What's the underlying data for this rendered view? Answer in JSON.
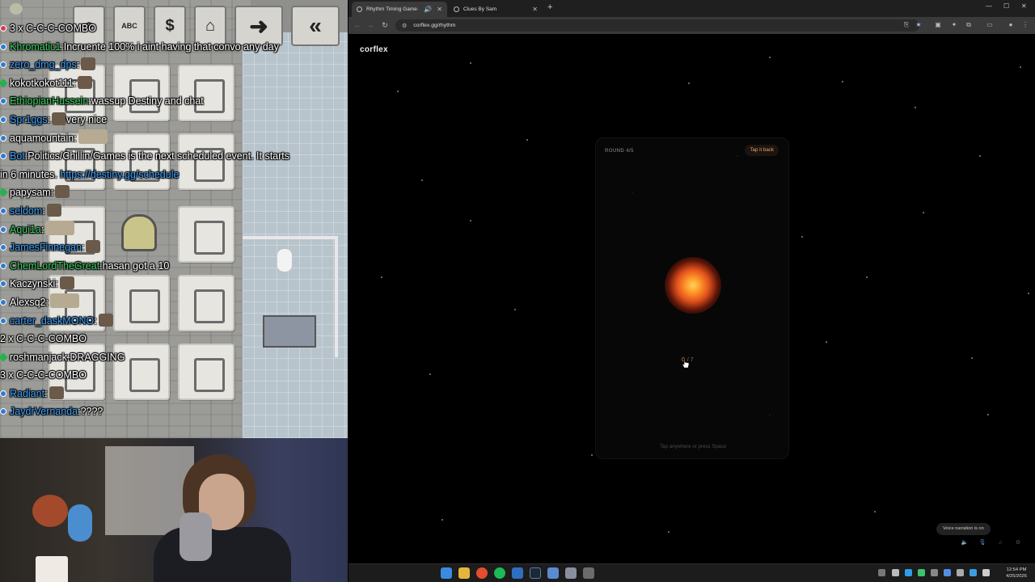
{
  "stream": {
    "chat": [
      {
        "badge": "pink",
        "user": "3 x ",
        "user_color": "white",
        "text": "C-C-C-COMBO",
        "emote": false
      },
      {
        "badge": "blue",
        "user": "Khromatic1",
        "user_color": "green",
        "text": "Incruente 100% i aint having that convo any day",
        "emote": false
      },
      {
        "badge": "blue",
        "user": "zero_dmg_dps",
        "user_color": "blue",
        "text": "",
        "emote": true
      },
      {
        "badge": "green",
        "user": "kokotkokot111",
        "user_color": "white",
        "text": "",
        "emote": true
      },
      {
        "badge": "blue",
        "user": "EthiopianHussein",
        "user_color": "green",
        "text": "wassup Destiny and chat",
        "emote": false
      },
      {
        "badge": "blue",
        "user": "Spr1ggs",
        "user_color": "blue",
        "text": "very nice",
        "emote": true
      },
      {
        "badge": "blue",
        "user": "aquamountain",
        "user_color": "white",
        "text": "",
        "emote": "got"
      },
      {
        "badge": "blue",
        "user": "Bot",
        "user_color": "blue",
        "text": "Politics/Chillin/Games is the next scheduled event. It starts",
        "emote": false
      },
      {
        "badge": "",
        "user": "",
        "user_color": "white",
        "text": "in 6 minutes. ",
        "link": "https://destiny.gg/schedule",
        "emote": false
      },
      {
        "badge": "green",
        "user": "papysam",
        "user_color": "white",
        "text": "",
        "emote": true
      },
      {
        "badge": "blue",
        "user": "seldom",
        "user_color": "blue",
        "text": "",
        "emote": true
      },
      {
        "badge": "blue",
        "user": "Aqui1a",
        "user_color": "green",
        "text": "",
        "emote": "got"
      },
      {
        "badge": "blue",
        "user": "JamesFinnegan",
        "user_color": "blue",
        "text": "",
        "emote": true
      },
      {
        "badge": "blue",
        "user": "ChemLordTheGreat",
        "user_color": "green",
        "text": "hasan got a 10",
        "emote": false
      },
      {
        "badge": "blue",
        "user": "Kaczynski",
        "user_color": "white",
        "text": "",
        "emote": true
      },
      {
        "badge": "blue",
        "user": "Alexsq2",
        "user_color": "white",
        "text": "",
        "emote": "got"
      },
      {
        "badge": "blue",
        "user": "carter_daskMONO",
        "user_color": "blue",
        "text": "",
        "emote": true
      },
      {
        "badge": "",
        "user": "2 x ",
        "user_color": "white",
        "text": "C-C-C-COMBO",
        "emote": false
      },
      {
        "badge": "green",
        "user": "roshmanjack",
        "user_color": "white",
        "text": "DRAGGING",
        "emote": false
      },
      {
        "badge": "",
        "user": "3 x ",
        "user_color": "white",
        "text": "C-C-C-COMBO",
        "emote": false
      },
      {
        "badge": "blue",
        "user": "Radiant",
        "user_color": "blue",
        "text": "",
        "emote": true
      },
      {
        "badge": "blue",
        "user": "JaydrVernanda",
        "user_color": "blue",
        "text": "????",
        "emote": false
      }
    ],
    "toolbar": {
      "abc": "ABC",
      "dollar": "$"
    }
  },
  "browser": {
    "tabs": [
      {
        "title": "Rhythm Timing Game — F",
        "active": true
      },
      {
        "title": "Clues By Sam",
        "active": false
      }
    ],
    "url": "corflex.gg/rhythm"
  },
  "page": {
    "logo": "corflex",
    "round_label": "ROUND 4/5",
    "tap_back": "Tap it back",
    "counter_current": "0",
    "counter_total": "/ 7",
    "hint": "Tap anywhere or press Space",
    "narration": "Voice narration is on",
    "colors": {
      "accent": "#f0a35c",
      "pulse": "#ff9a2a"
    }
  },
  "taskbar": {
    "time": "12:54 PM",
    "date": "4/25/2026"
  }
}
